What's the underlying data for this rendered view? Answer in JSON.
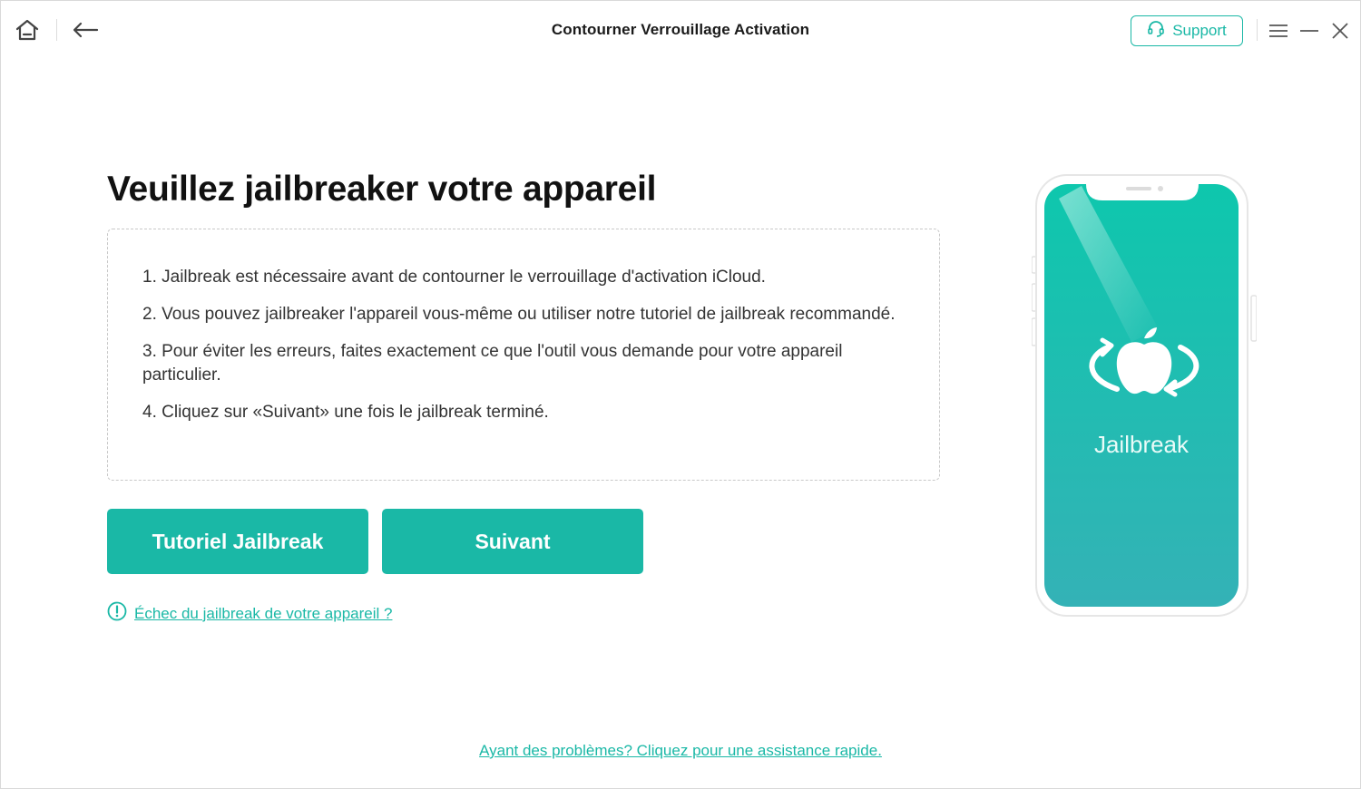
{
  "titlebar": {
    "title": "Contourner Verrouillage Activation",
    "support_label": "Support"
  },
  "main": {
    "heading": "Veuillez jailbreaker votre appareil",
    "steps": [
      "1. Jailbreak est nécessaire avant de contourner le verrouillage d'activation iCloud.",
      "2. Vous pouvez jailbreaker l'appareil vous-même ou utiliser notre tutoriel de jailbreak recommandé.",
      "3. Pour éviter les erreurs, faites exactement ce que l'outil vous demande pour votre appareil particulier.",
      "4. Cliquez sur «Suivant» une fois le jailbreak terminé."
    ],
    "tutorial_button": "Tutoriel Jailbreak",
    "next_button": "Suivant",
    "fail_link": "Échec du jailbreak de votre appareil ?",
    "help_link": "Ayant des problèmes? Cliquez pour une assistance rapide."
  },
  "phone": {
    "label": "Jailbreak"
  },
  "colors": {
    "accent": "#1ab8a6",
    "phone_top": "#0ec7ad",
    "phone_bottom": "#34b2b6"
  },
  "icons": [
    "home-icon",
    "back-icon",
    "headset-icon",
    "menu-icon",
    "minimize-icon",
    "close-icon",
    "warning-icon",
    "apple-icon"
  ]
}
